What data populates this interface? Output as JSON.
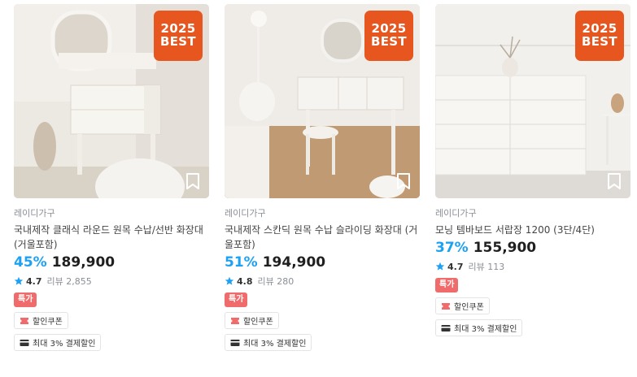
{
  "products": [
    {
      "best_badge": {
        "year": "2025",
        "label": "BEST"
      },
      "brand": "레이디가구",
      "title": "국내제작 클래식 라운드 원목 수납/선반 화장대 (거울포함)",
      "discount": "45%",
      "price": "189,900",
      "rating": "4.7",
      "reviews": "리뷰 2,855",
      "sale_badge": "특가",
      "coupon_chip": "할인쿠폰",
      "payment_chip": "최대 3% 결제할인"
    },
    {
      "best_badge": {
        "year": "2025",
        "label": "BEST"
      },
      "brand": "레이디가구",
      "title": "국내제작 스칸딕 원목 수납 슬라이딩 화장대 (거울포함)",
      "discount": "51%",
      "price": "194,900",
      "rating": "4.8",
      "reviews": "리뷰 280",
      "sale_badge": "특가",
      "coupon_chip": "할인쿠폰",
      "payment_chip": "최대 3% 결제할인"
    },
    {
      "best_badge": {
        "year": "2025",
        "label": "BEST"
      },
      "brand": "레이디가구",
      "title": "모닝 템바보드 서랍장 1200 (3단/4단)",
      "discount": "37%",
      "price": "155,900",
      "rating": "4.7",
      "reviews": "리뷰 113",
      "sale_badge": "특가",
      "coupon_chip": "할인쿠폰",
      "payment_chip": "최대 3% 결제할인"
    }
  ],
  "colors": {
    "discount": "#1ea1f2",
    "best_badge": "#e8561f",
    "sale_badge": "#f06b6b",
    "star": "#1ea1f2"
  },
  "icons": {
    "bookmark": "bookmark-icon",
    "star": "star-icon",
    "coupon": "coupon-icon",
    "card": "card-icon"
  }
}
